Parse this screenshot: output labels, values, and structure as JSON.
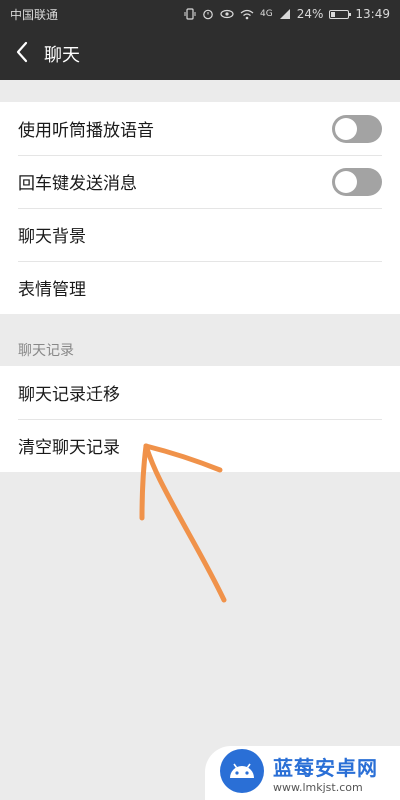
{
  "status_bar": {
    "carrier": "中国联通",
    "network": "4G",
    "battery": "24%",
    "battery_level": 0.24,
    "time": "13:49"
  },
  "header": {
    "title": "聊天"
  },
  "settings": {
    "items": [
      {
        "label": "使用听筒播放语音",
        "toggle": false
      },
      {
        "label": "回车键发送消息",
        "toggle": false
      },
      {
        "label": "聊天背景"
      },
      {
        "label": "表情管理"
      }
    ]
  },
  "chat_history": {
    "section_label": "聊天记录",
    "items": [
      {
        "label": "聊天记录迁移"
      },
      {
        "label": "清空聊天记录"
      }
    ]
  },
  "watermark": {
    "title": "蓝莓安卓网",
    "url": "www.lmkjst.com"
  },
  "colors": {
    "header_bg": "#2e2e2e",
    "page_bg": "#ebebeb",
    "toggle_off": "#a3a3a3",
    "annotation_arrow": "#f0924a",
    "watermark_blue": "#2a6fd6"
  }
}
